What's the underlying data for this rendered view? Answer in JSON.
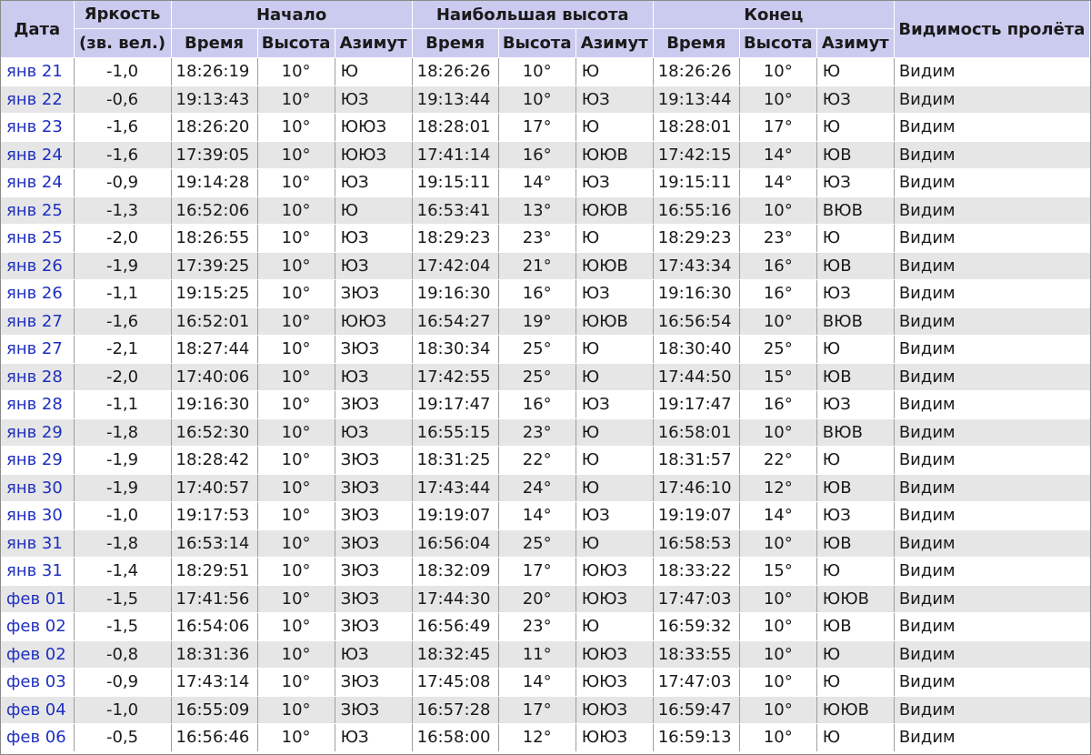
{
  "header": {
    "date": "Дата",
    "brightness_line1": "Яркость",
    "brightness_line2": "(зв. вел.)",
    "start": "Начало",
    "max": "Наибольшая высота",
    "end": "Конец",
    "visibility": "Видимость пролёта",
    "time": "Время",
    "altitude": "Высота",
    "azimuth": "Азимут"
  },
  "colors": {
    "header_bg": "#cbcbf0",
    "row_alt_bg": "#e6e6e6",
    "date_link": "#1f2fbf"
  },
  "rows": [
    [
      "янв 21",
      "-1,0",
      "18:26:19",
      "10°",
      "Ю",
      "18:26:26",
      "10°",
      "Ю",
      "18:26:26",
      "10°",
      "Ю",
      "Видим"
    ],
    [
      "янв 22",
      "-0,6",
      "19:13:43",
      "10°",
      "ЮЗ",
      "19:13:44",
      "10°",
      "ЮЗ",
      "19:13:44",
      "10°",
      "ЮЗ",
      "Видим"
    ],
    [
      "янв 23",
      "-1,6",
      "18:26:20",
      "10°",
      "ЮЮЗ",
      "18:28:01",
      "17°",
      "Ю",
      "18:28:01",
      "17°",
      "Ю",
      "Видим"
    ],
    [
      "янв 24",
      "-1,6",
      "17:39:05",
      "10°",
      "ЮЮЗ",
      "17:41:14",
      "16°",
      "ЮЮВ",
      "17:42:15",
      "14°",
      "ЮВ",
      "Видим"
    ],
    [
      "янв 24",
      "-0,9",
      "19:14:28",
      "10°",
      "ЮЗ",
      "19:15:11",
      "14°",
      "ЮЗ",
      "19:15:11",
      "14°",
      "ЮЗ",
      "Видим"
    ],
    [
      "янв 25",
      "-1,3",
      "16:52:06",
      "10°",
      "Ю",
      "16:53:41",
      "13°",
      "ЮЮВ",
      "16:55:16",
      "10°",
      "ВЮВ",
      "Видим"
    ],
    [
      "янв 25",
      "-2,0",
      "18:26:55",
      "10°",
      "ЮЗ",
      "18:29:23",
      "23°",
      "Ю",
      "18:29:23",
      "23°",
      "Ю",
      "Видим"
    ],
    [
      "янв 26",
      "-1,9",
      "17:39:25",
      "10°",
      "ЮЗ",
      "17:42:04",
      "21°",
      "ЮЮВ",
      "17:43:34",
      "16°",
      "ЮВ",
      "Видим"
    ],
    [
      "янв 26",
      "-1,1",
      "19:15:25",
      "10°",
      "ЗЮЗ",
      "19:16:30",
      "16°",
      "ЮЗ",
      "19:16:30",
      "16°",
      "ЮЗ",
      "Видим"
    ],
    [
      "янв 27",
      "-1,6",
      "16:52:01",
      "10°",
      "ЮЮЗ",
      "16:54:27",
      "19°",
      "ЮЮВ",
      "16:56:54",
      "10°",
      "ВЮВ",
      "Видим"
    ],
    [
      "янв 27",
      "-2,1",
      "18:27:44",
      "10°",
      "ЗЮЗ",
      "18:30:34",
      "25°",
      "Ю",
      "18:30:40",
      "25°",
      "Ю",
      "Видим"
    ],
    [
      "янв 28",
      "-2,0",
      "17:40:06",
      "10°",
      "ЮЗ",
      "17:42:55",
      "25°",
      "Ю",
      "17:44:50",
      "15°",
      "ЮВ",
      "Видим"
    ],
    [
      "янв 28",
      "-1,1",
      "19:16:30",
      "10°",
      "ЗЮЗ",
      "19:17:47",
      "16°",
      "ЮЗ",
      "19:17:47",
      "16°",
      "ЮЗ",
      "Видим"
    ],
    [
      "янв 29",
      "-1,8",
      "16:52:30",
      "10°",
      "ЮЗ",
      "16:55:15",
      "23°",
      "Ю",
      "16:58:01",
      "10°",
      "ВЮВ",
      "Видим"
    ],
    [
      "янв 29",
      "-1,9",
      "18:28:42",
      "10°",
      "ЗЮЗ",
      "18:31:25",
      "22°",
      "Ю",
      "18:31:57",
      "22°",
      "Ю",
      "Видим"
    ],
    [
      "янв 30",
      "-1,9",
      "17:40:57",
      "10°",
      "ЗЮЗ",
      "17:43:44",
      "24°",
      "Ю",
      "17:46:10",
      "12°",
      "ЮВ",
      "Видим"
    ],
    [
      "янв 30",
      "-1,0",
      "19:17:53",
      "10°",
      "ЗЮЗ",
      "19:19:07",
      "14°",
      "ЮЗ",
      "19:19:07",
      "14°",
      "ЮЗ",
      "Видим"
    ],
    [
      "янв 31",
      "-1,8",
      "16:53:14",
      "10°",
      "ЗЮЗ",
      "16:56:04",
      "25°",
      "Ю",
      "16:58:53",
      "10°",
      "ЮВ",
      "Видим"
    ],
    [
      "янв 31",
      "-1,4",
      "18:29:51",
      "10°",
      "ЗЮЗ",
      "18:32:09",
      "17°",
      "ЮЮЗ",
      "18:33:22",
      "15°",
      "Ю",
      "Видим"
    ],
    [
      "фев 01",
      "-1,5",
      "17:41:56",
      "10°",
      "ЗЮЗ",
      "17:44:30",
      "20°",
      "ЮЮЗ",
      "17:47:03",
      "10°",
      "ЮЮВ",
      "Видим"
    ],
    [
      "фев 02",
      "-1,5",
      "16:54:06",
      "10°",
      "ЗЮЗ",
      "16:56:49",
      "23°",
      "Ю",
      "16:59:32",
      "10°",
      "ЮВ",
      "Видим"
    ],
    [
      "фев 02",
      "-0,8",
      "18:31:36",
      "10°",
      "ЮЗ",
      "18:32:45",
      "11°",
      "ЮЮЗ",
      "18:33:55",
      "10°",
      "Ю",
      "Видим"
    ],
    [
      "фев 03",
      "-0,9",
      "17:43:14",
      "10°",
      "ЗЮЗ",
      "17:45:08",
      "14°",
      "ЮЮЗ",
      "17:47:03",
      "10°",
      "Ю",
      "Видим"
    ],
    [
      "фев 04",
      "-1,0",
      "16:55:09",
      "10°",
      "ЗЮЗ",
      "16:57:28",
      "17°",
      "ЮЮЗ",
      "16:59:47",
      "10°",
      "ЮЮВ",
      "Видим"
    ],
    [
      "фев 06",
      "-0,5",
      "16:56:46",
      "10°",
      "ЮЗ",
      "16:58:00",
      "12°",
      "ЮЮЗ",
      "16:59:13",
      "10°",
      "Ю",
      "Видим"
    ]
  ]
}
